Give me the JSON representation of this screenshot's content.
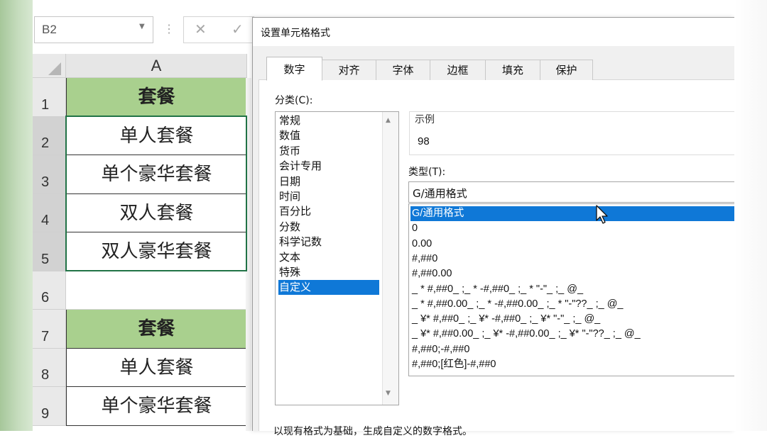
{
  "excel": {
    "namebox": "B2",
    "cancel_glyph": "✕",
    "ok_glyph": "✓",
    "sep_glyph": "⋮",
    "column_header": "A",
    "rows": [
      {
        "num": "1",
        "text": "套餐",
        "header": true
      },
      {
        "num": "2",
        "text": "单人套餐"
      },
      {
        "num": "3",
        "text": "单个豪华套餐"
      },
      {
        "num": "4",
        "text": "双人套餐"
      },
      {
        "num": "5",
        "text": "双人豪华套餐"
      },
      {
        "num": "6",
        "text": ""
      },
      {
        "num": "7",
        "text": "套餐",
        "header": true
      },
      {
        "num": "8",
        "text": "单人套餐"
      },
      {
        "num": "9",
        "text": "单个豪华套餐"
      }
    ],
    "header_fill": "#a9d08e",
    "selection_color": "#217346"
  },
  "dialog": {
    "title": "设置单元格格式",
    "tabs": [
      "数字",
      "对齐",
      "字体",
      "边框",
      "填充",
      "保护"
    ],
    "active_tab": "数字",
    "category_label": "分类(C):",
    "categories": [
      "常规",
      "数值",
      "货币",
      "会计专用",
      "日期",
      "时间",
      "百分比",
      "分数",
      "科学记数",
      "文本",
      "特殊",
      "自定义"
    ],
    "selected_category": "自定义",
    "sample_label": "示例",
    "sample_value": "98",
    "type_label": "类型(T):",
    "type_value": "G/通用格式",
    "type_options": [
      "G/通用格式",
      "0",
      "0.00",
      "#,##0",
      "#,##0.00",
      "_ * #,##0_ ;_ * -#,##0_ ;_ * \"-\"_ ;_ @_",
      "_ * #,##0.00_ ;_ * -#,##0.00_ ;_ * \"-\"??_ ;_ @_",
      "_ ¥* #,##0_ ;_ ¥* -#,##0_ ;_ ¥* \"-\"_ ;_ @_",
      "_ ¥* #,##0.00_ ;_ ¥* -#,##0.00_ ;_ ¥* \"-\"??_ ;_ @_",
      "#,##0;-#,##0",
      "#,##0;[红色]-#,##0"
    ],
    "selected_type": "G/通用格式",
    "bottom_text": "以现有格式为基础，生成自定义的数字格式。",
    "selection_color": "#0f78d7"
  }
}
